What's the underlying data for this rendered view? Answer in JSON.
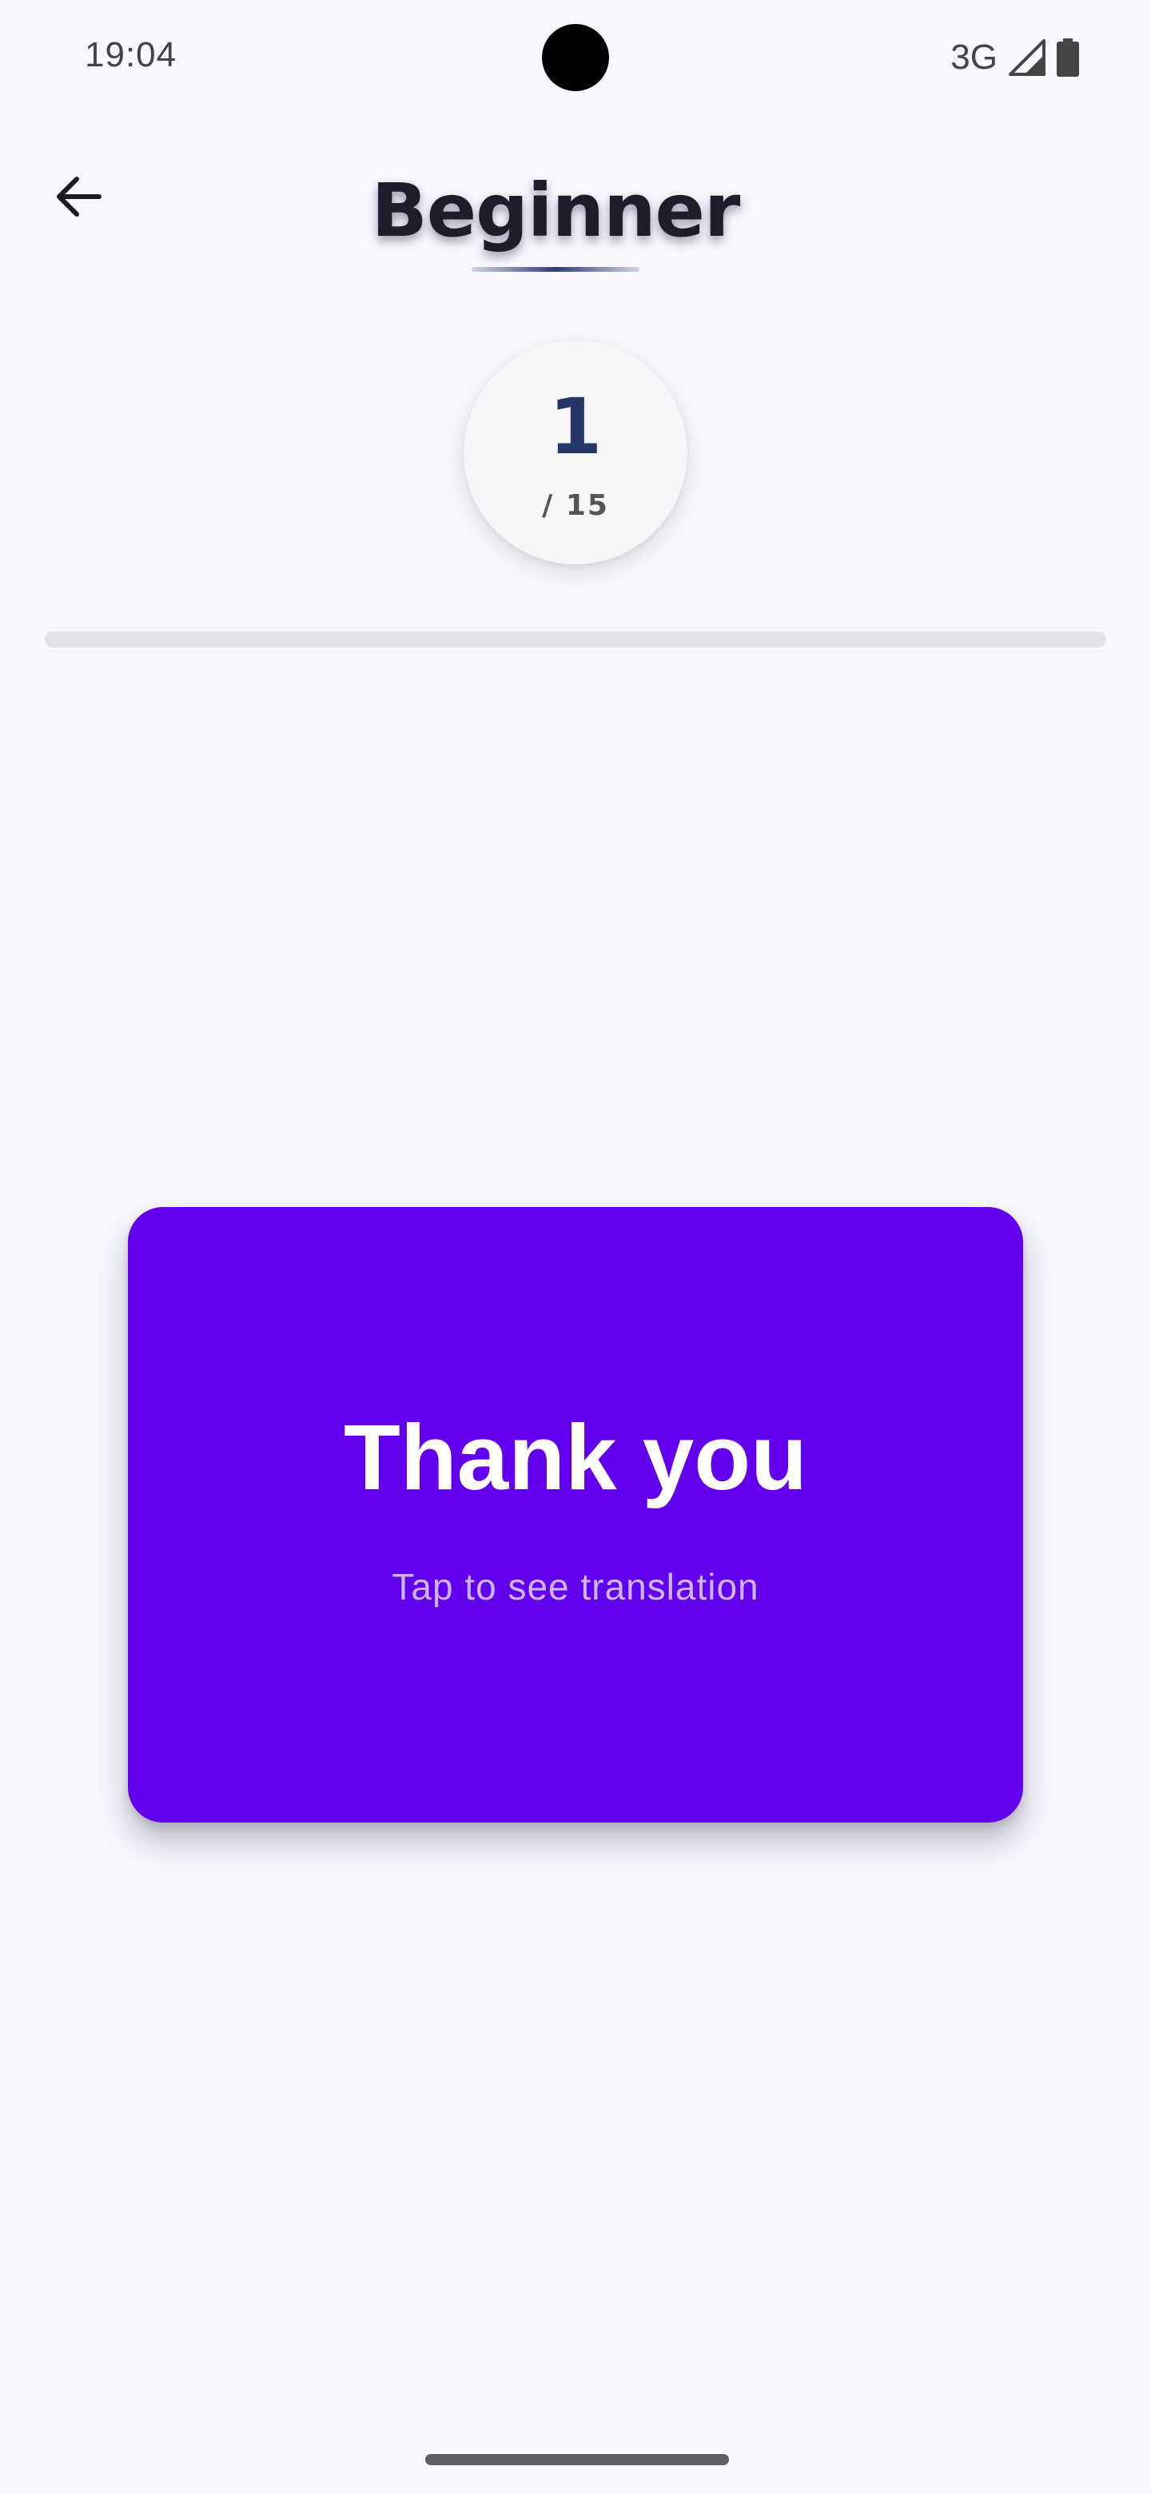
{
  "status_bar": {
    "time": "19:04",
    "network": "3G",
    "icons": [
      "signal-icon",
      "battery-icon"
    ]
  },
  "header": {
    "back_icon": "arrow-left-icon",
    "title": "Beginner"
  },
  "counter": {
    "current": "1",
    "total": "/ 15"
  },
  "progress": {
    "value": 0.0
  },
  "card": {
    "word": "Thank you",
    "hint": "Tap to see translation",
    "color": "#6200ee"
  },
  "colors": {
    "background": "#f8f7fd",
    "accent": "#6200ee",
    "counter_number": "#243766",
    "progress_track": "#e3e2e8"
  }
}
